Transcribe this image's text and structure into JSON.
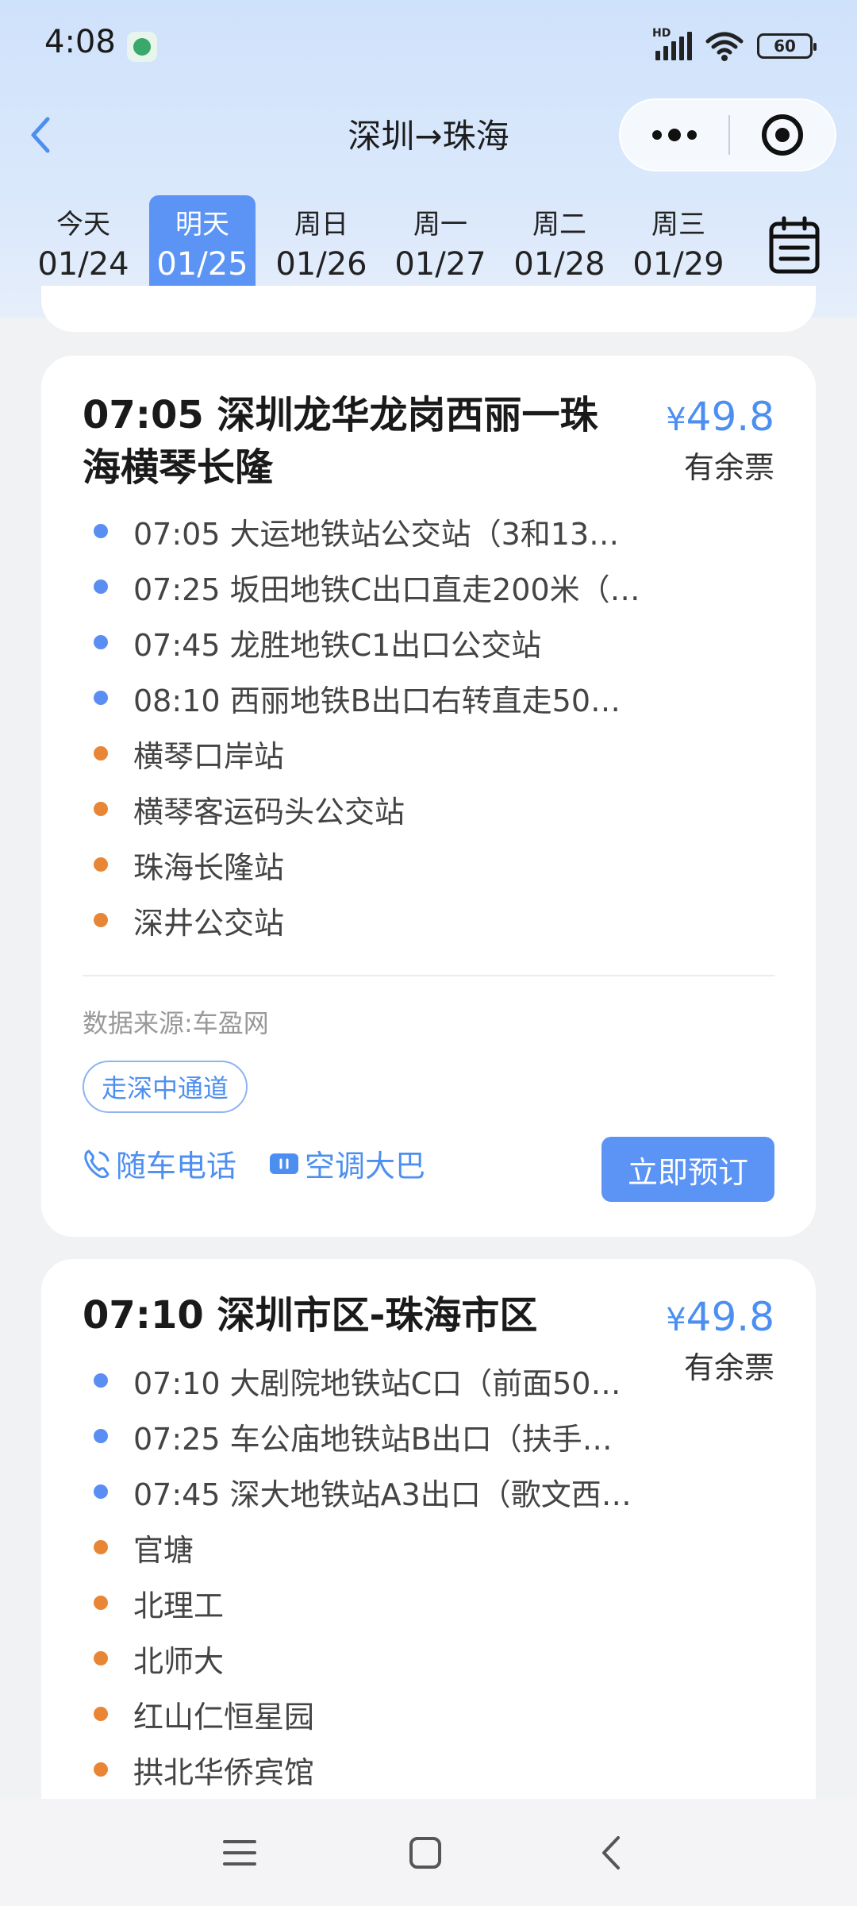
{
  "status_bar": {
    "time": "4:08",
    "network": "HD",
    "battery": "60"
  },
  "nav": {
    "title": "深圳→珠海"
  },
  "date_tabs": [
    {
      "weekday": "今天",
      "date": "01/24",
      "active": false
    },
    {
      "weekday": "明天",
      "date": "01/25",
      "active": true
    },
    {
      "weekday": "周日",
      "date": "01/26",
      "active": false
    },
    {
      "weekday": "周一",
      "date": "01/27",
      "active": false
    },
    {
      "weekday": "周二",
      "date": "01/28",
      "active": false
    },
    {
      "weekday": "周三",
      "date": "01/29",
      "active": false
    }
  ],
  "trips": [
    {
      "title_line1": "07:05 深圳龙华龙岗西丽一珠",
      "title_line2": "海横琴长隆",
      "price_symbol": "¥",
      "price": "49.8",
      "status": "有余票",
      "stops": [
        {
          "text": "07:05  大运地铁站公交站（3和13…",
          "type": "boarding"
        },
        {
          "text": "07:25  坂田地铁C出口直走200米（…",
          "type": "boarding"
        },
        {
          "text": "07:45  龙胜地铁C1出口公交站",
          "type": "boarding"
        },
        {
          "text": "08:10  西丽地铁B出口右转直走50…",
          "type": "boarding"
        },
        {
          "text": "横琴口岸站",
          "type": "alighting"
        },
        {
          "text": "横琴客运码头公交站",
          "type": "alighting"
        },
        {
          "text": "珠海长隆站",
          "type": "alighting"
        },
        {
          "text": "深井公交站",
          "type": "alighting"
        }
      ],
      "source": "数据来源:车盈网",
      "tag": "走深中通道",
      "feature_phone": "随车电话",
      "feature_ac": "空调大巴",
      "book_label": "立即预订"
    },
    {
      "title_line1": "07:10 深圳市区-珠海市区",
      "price_symbol": "¥",
      "price": "49.8",
      "status": "有余票",
      "stops": [
        {
          "text": "07:10  大剧院地铁站C口（前面50…",
          "type": "boarding"
        },
        {
          "text": "07:25  车公庙地铁站B出口（扶手…",
          "type": "boarding"
        },
        {
          "text": "07:45  深大地铁站A3出口（歌文西…",
          "type": "boarding"
        },
        {
          "text": "官塘",
          "type": "alighting"
        },
        {
          "text": "北理工",
          "type": "alighting"
        },
        {
          "text": "北师大",
          "type": "alighting"
        },
        {
          "text": "红山仁恒星园",
          "type": "alighting"
        },
        {
          "text": "拱北华侨宾馆",
          "type": "alighting"
        }
      ]
    }
  ],
  "colors": {
    "accent": "#5b94f5",
    "boarding_dot": "#5b8ef2",
    "alighting_dot": "#e88636"
  }
}
